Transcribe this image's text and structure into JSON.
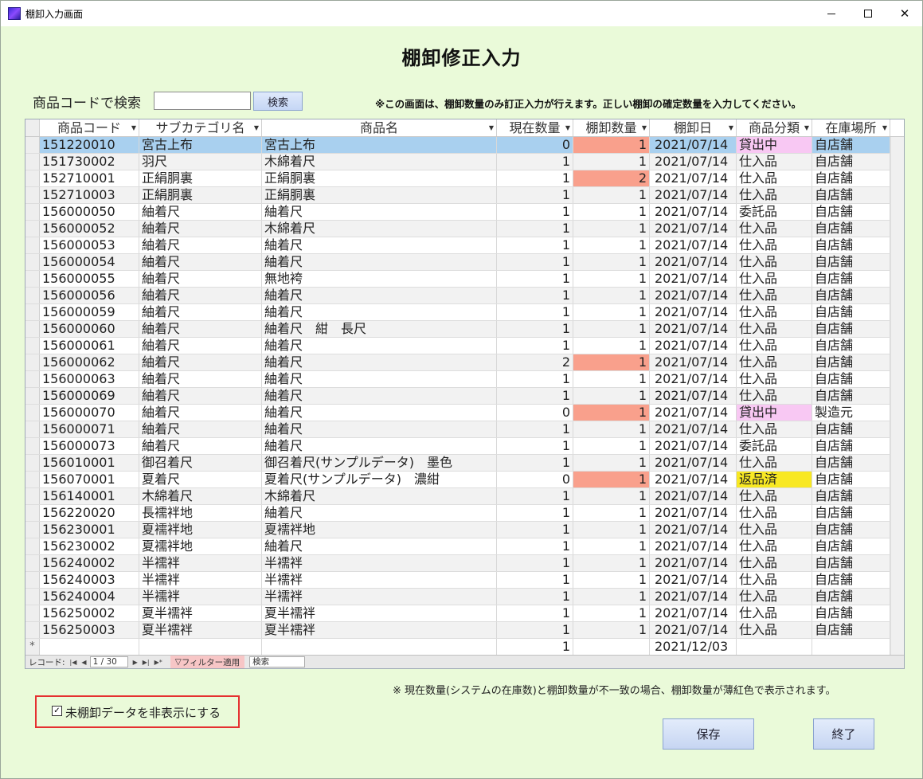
{
  "window": {
    "title": "棚卸入力画面"
  },
  "page_title": "棚卸修正入力",
  "search": {
    "label": "商品コードで検索",
    "button": "検索",
    "value": ""
  },
  "notice_top": "※この画面は、棚卸数量のみ訂正入力が行えます。正しい棚卸の確定数量を入力してください。",
  "columns": [
    "商品コード",
    "サブカテゴリ名",
    "商品名",
    "現在数量",
    "棚卸数量",
    "棚卸日",
    "商品分類",
    "在庫場所"
  ],
  "rows": [
    {
      "code": "151220010",
      "sub": "宮古上布",
      "name": "宮古上布",
      "cur": "0",
      "inv": "1",
      "date": "2021/07/14",
      "cat": "貸出中",
      "loc": "自店舗",
      "mismatch": true,
      "cat_style": "rent",
      "selected": true
    },
    {
      "code": "151730002",
      "sub": "羽尺",
      "name": "木綿着尺",
      "cur": "1",
      "inv": "1",
      "date": "2021/07/14",
      "cat": "仕入品",
      "loc": "自店舗"
    },
    {
      "code": "152710001",
      "sub": "正絹胴裏",
      "name": "正絹胴裏",
      "cur": "1",
      "inv": "2",
      "date": "2021/07/14",
      "cat": "仕入品",
      "loc": "自店舗",
      "mismatch": true
    },
    {
      "code": "152710003",
      "sub": "正絹胴裏",
      "name": "正絹胴裏",
      "cur": "1",
      "inv": "1",
      "date": "2021/07/14",
      "cat": "仕入品",
      "loc": "自店舗"
    },
    {
      "code": "156000050",
      "sub": "紬着尺",
      "name": "紬着尺",
      "cur": "1",
      "inv": "1",
      "date": "2021/07/14",
      "cat": "委託品",
      "loc": "自店舗"
    },
    {
      "code": "156000052",
      "sub": "紬着尺",
      "name": "木綿着尺",
      "cur": "1",
      "inv": "1",
      "date": "2021/07/14",
      "cat": "仕入品",
      "loc": "自店舗"
    },
    {
      "code": "156000053",
      "sub": "紬着尺",
      "name": "紬着尺",
      "cur": "1",
      "inv": "1",
      "date": "2021/07/14",
      "cat": "仕入品",
      "loc": "自店舗"
    },
    {
      "code": "156000054",
      "sub": "紬着尺",
      "name": "紬着尺",
      "cur": "1",
      "inv": "1",
      "date": "2021/07/14",
      "cat": "仕入品",
      "loc": "自店舗"
    },
    {
      "code": "156000055",
      "sub": "紬着尺",
      "name": "無地袴",
      "cur": "1",
      "inv": "1",
      "date": "2021/07/14",
      "cat": "仕入品",
      "loc": "自店舗"
    },
    {
      "code": "156000056",
      "sub": "紬着尺",
      "name": "紬着尺",
      "cur": "1",
      "inv": "1",
      "date": "2021/07/14",
      "cat": "仕入品",
      "loc": "自店舗"
    },
    {
      "code": "156000059",
      "sub": "紬着尺",
      "name": "紬着尺",
      "cur": "1",
      "inv": "1",
      "date": "2021/07/14",
      "cat": "仕入品",
      "loc": "自店舗"
    },
    {
      "code": "156000060",
      "sub": "紬着尺",
      "name": "紬着尺　紺　長尺",
      "cur": "1",
      "inv": "1",
      "date": "2021/07/14",
      "cat": "仕入品",
      "loc": "自店舗"
    },
    {
      "code": "156000061",
      "sub": "紬着尺",
      "name": "紬着尺",
      "cur": "1",
      "inv": "1",
      "date": "2021/07/14",
      "cat": "仕入品",
      "loc": "自店舗"
    },
    {
      "code": "156000062",
      "sub": "紬着尺",
      "name": "紬着尺",
      "cur": "2",
      "inv": "1",
      "date": "2021/07/14",
      "cat": "仕入品",
      "loc": "自店舗",
      "mismatch": true
    },
    {
      "code": "156000063",
      "sub": "紬着尺",
      "name": "紬着尺",
      "cur": "1",
      "inv": "1",
      "date": "2021/07/14",
      "cat": "仕入品",
      "loc": "自店舗"
    },
    {
      "code": "156000069",
      "sub": "紬着尺",
      "name": "紬着尺",
      "cur": "1",
      "inv": "1",
      "date": "2021/07/14",
      "cat": "仕入品",
      "loc": "自店舗"
    },
    {
      "code": "156000070",
      "sub": "紬着尺",
      "name": "紬着尺",
      "cur": "0",
      "inv": "1",
      "date": "2021/07/14",
      "cat": "貸出中",
      "loc": "製造元",
      "mismatch": true,
      "cat_style": "rent"
    },
    {
      "code": "156000071",
      "sub": "紬着尺",
      "name": "紬着尺",
      "cur": "1",
      "inv": "1",
      "date": "2021/07/14",
      "cat": "仕入品",
      "loc": "自店舗"
    },
    {
      "code": "156000073",
      "sub": "紬着尺",
      "name": "紬着尺",
      "cur": "1",
      "inv": "1",
      "date": "2021/07/14",
      "cat": "委託品",
      "loc": "自店舗"
    },
    {
      "code": "156010001",
      "sub": "御召着尺",
      "name": "御召着尺(サンプルデータ)　墨色",
      "cur": "1",
      "inv": "1",
      "date": "2021/07/14",
      "cat": "仕入品",
      "loc": "自店舗"
    },
    {
      "code": "156070001",
      "sub": "夏着尺",
      "name": "夏着尺(サンプルデータ)　濃紺",
      "cur": "0",
      "inv": "1",
      "date": "2021/07/14",
      "cat": "返品済",
      "loc": "自店舗",
      "mismatch": true,
      "cat_style": "return"
    },
    {
      "code": "156140001",
      "sub": "木綿着尺",
      "name": "木綿着尺",
      "cur": "1",
      "inv": "1",
      "date": "2021/07/14",
      "cat": "仕入品",
      "loc": "自店舗"
    },
    {
      "code": "156220020",
      "sub": "長襦袢地",
      "name": "紬着尺",
      "cur": "1",
      "inv": "1",
      "date": "2021/07/14",
      "cat": "仕入品",
      "loc": "自店舗"
    },
    {
      "code": "156230001",
      "sub": "夏襦袢地",
      "name": "夏襦袢地",
      "cur": "1",
      "inv": "1",
      "date": "2021/07/14",
      "cat": "仕入品",
      "loc": "自店舗"
    },
    {
      "code": "156230002",
      "sub": "夏襦袢地",
      "name": "紬着尺",
      "cur": "1",
      "inv": "1",
      "date": "2021/07/14",
      "cat": "仕入品",
      "loc": "自店舗"
    },
    {
      "code": "156240002",
      "sub": "半襦袢",
      "name": "半襦袢",
      "cur": "1",
      "inv": "1",
      "date": "2021/07/14",
      "cat": "仕入品",
      "loc": "自店舗"
    },
    {
      "code": "156240003",
      "sub": "半襦袢",
      "name": "半襦袢",
      "cur": "1",
      "inv": "1",
      "date": "2021/07/14",
      "cat": "仕入品",
      "loc": "自店舗"
    },
    {
      "code": "156240004",
      "sub": "半襦袢",
      "name": "半襦袢",
      "cur": "1",
      "inv": "1",
      "date": "2021/07/14",
      "cat": "仕入品",
      "loc": "自店舗"
    },
    {
      "code": "156250002",
      "sub": "夏半襦袢",
      "name": "夏半襦袢",
      "cur": "1",
      "inv": "1",
      "date": "2021/07/14",
      "cat": "仕入品",
      "loc": "自店舗"
    },
    {
      "code": "156250003",
      "sub": "夏半襦袢",
      "name": "夏半襦袢",
      "cur": "1",
      "inv": "1",
      "date": "2021/07/14",
      "cat": "仕入品",
      "loc": "自店舗"
    }
  ],
  "new_row": {
    "marker": "*",
    "cur": "1",
    "date": "2021/12/03"
  },
  "navigation": {
    "label": "レコード:",
    "position": "1 / 30",
    "filter": "フィルター適用",
    "search": "検索"
  },
  "notice_bottom": "※ 現在数量(システムの在庫数)と棚卸数量が不一致の場合、棚卸数量が薄紅色で表示されます。",
  "hide_option": {
    "label": "未棚卸データを非表示にする",
    "checked": true
  },
  "buttons": {
    "save": "保存",
    "exit": "終了"
  },
  "colors": {
    "background": "#eafad9",
    "mismatch": "#f9a08c",
    "rent": "#f8c8f3",
    "returned": "#f8e823",
    "selected": "#a9d0ef"
  }
}
